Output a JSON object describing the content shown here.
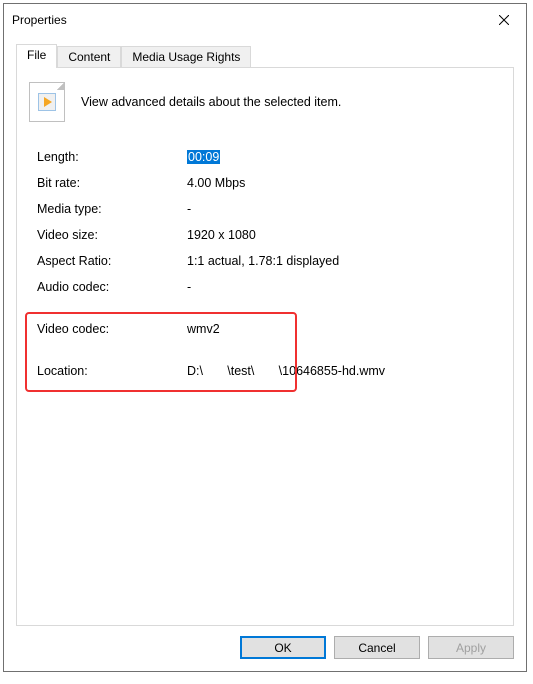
{
  "window": {
    "title": "Properties"
  },
  "tabs": {
    "file": "File",
    "content": "Content",
    "media_usage_rights": "Media Usage Rights"
  },
  "header": {
    "description": "View advanced details about the selected item."
  },
  "properties": {
    "length_label": "Length:",
    "length_value": "00:09",
    "bitrate_label": "Bit rate:",
    "bitrate_value": "4.00 Mbps",
    "mediatype_label": "Media type:",
    "mediatype_value": "-",
    "videosize_label": "Video size:",
    "videosize_value": "1920 x 1080",
    "aspect_label": "Aspect Ratio:",
    "aspect_value": "1:1 actual, 1.78:1 displayed",
    "audiocodec_label": "Audio codec:",
    "audiocodec_value": "-",
    "videocodec_label": "Video codec:",
    "videocodec_value": "wmv2",
    "location_label": "Location:",
    "location_value": "D:\\       \\test\\       \\10646855-hd.wmv"
  },
  "buttons": {
    "ok": "OK",
    "cancel": "Cancel",
    "apply": "Apply"
  }
}
